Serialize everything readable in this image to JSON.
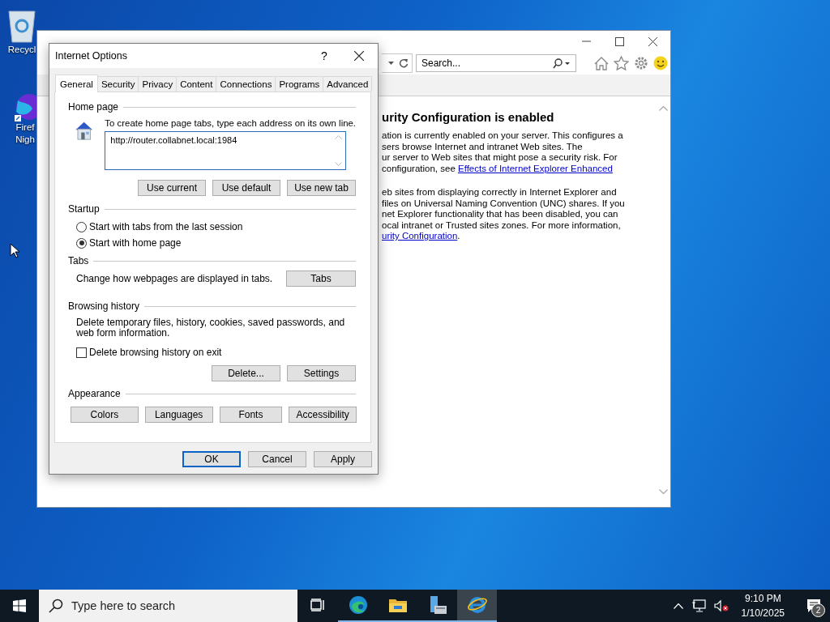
{
  "desktop": {
    "icons": [
      {
        "kind": "recycle-bin",
        "label_lines": [
          "Recycl"
        ]
      },
      {
        "kind": "fox",
        "label_lines": [
          "Firef",
          "Nigh"
        ]
      }
    ]
  },
  "browser": {
    "search": {
      "placeholder": "Search..."
    },
    "heading": "urity Configuration is enabled",
    "paragraphs": [
      [
        [
          {
            "kind": "text",
            "text": "ation is currently enabled on your server. This configures a"
          }
        ],
        [
          {
            "kind": "text",
            "text": "sers browse Internet and intranet Web sites. The"
          }
        ],
        [
          {
            "kind": "text",
            "text": "ur server to Web sites that might pose a security risk. For"
          }
        ],
        [
          {
            "kind": "text",
            "text": "configuration, see "
          },
          {
            "kind": "link",
            "text": "Effects of Internet Explorer Enhanced"
          }
        ]
      ],
      [
        [
          {
            "kind": "text",
            "text": "eb sites from displaying correctly in Internet Explorer and"
          }
        ],
        [
          {
            "kind": "text",
            "text": "files on Universal Naming Convention (UNC) shares. If you"
          }
        ],
        [
          {
            "kind": "text",
            "text": "net Explorer functionality that has been disabled, you can"
          }
        ],
        [
          {
            "kind": "text",
            "text": "ocal intranet or Trusted sites zones. For more information,"
          }
        ],
        [
          {
            "kind": "link",
            "text": "urity Configuration"
          },
          {
            "kind": "text",
            "text": "."
          }
        ]
      ]
    ]
  },
  "dialog": {
    "title": "Internet Options",
    "help": "?",
    "tabs": [
      {
        "label": "General",
        "selected": true
      },
      {
        "label": "Security",
        "selected": false
      },
      {
        "label": "Privacy",
        "selected": false
      },
      {
        "label": "Content",
        "selected": false
      },
      {
        "label": "Connections",
        "selected": false
      },
      {
        "label": "Programs",
        "selected": false
      },
      {
        "label": "Advanced",
        "selected": false
      }
    ],
    "home_page": {
      "heading": "Home page",
      "hint": "To create home page tabs, type each address on its own line.",
      "value": "http://router.collabnet.local:1984",
      "buttons": [
        "Use current",
        "Use default",
        "Use new tab"
      ]
    },
    "startup": {
      "heading": "Startup",
      "options": [
        {
          "label": "Start with tabs from the last session",
          "selected": false
        },
        {
          "label": "Start with home page",
          "selected": true
        }
      ]
    },
    "tabs_section": {
      "heading": "Tabs",
      "text": "Change how webpages are displayed in tabs.",
      "button": "Tabs"
    },
    "browsing_history": {
      "heading": "Browsing history",
      "text": "Delete temporary files, history, cookies, saved passwords, and web form information.",
      "checkbox": {
        "label": "Delete browsing history on exit",
        "checked": false
      },
      "buttons": [
        "Delete...",
        "Settings"
      ]
    },
    "appearance": {
      "heading": "Appearance",
      "buttons": [
        "Colors",
        "Languages",
        "Fonts",
        "Accessibility"
      ]
    },
    "footer_buttons": [
      {
        "label": "OK",
        "default": true
      },
      {
        "label": "Cancel",
        "default": false
      },
      {
        "label": "Apply",
        "default": false
      }
    ]
  },
  "taskbar": {
    "search_placeholder": "Type here to search",
    "apps": [
      {
        "kind": "task-view",
        "running": false,
        "active": false
      },
      {
        "kind": "edge",
        "running": true,
        "active": false
      },
      {
        "kind": "folder",
        "running": true,
        "active": false
      },
      {
        "kind": "server",
        "running": true,
        "active": false
      },
      {
        "kind": "ie",
        "running": true,
        "active": true
      }
    ],
    "time": "9:10 PM",
    "date": "1/10/2025",
    "notifications": "2"
  }
}
